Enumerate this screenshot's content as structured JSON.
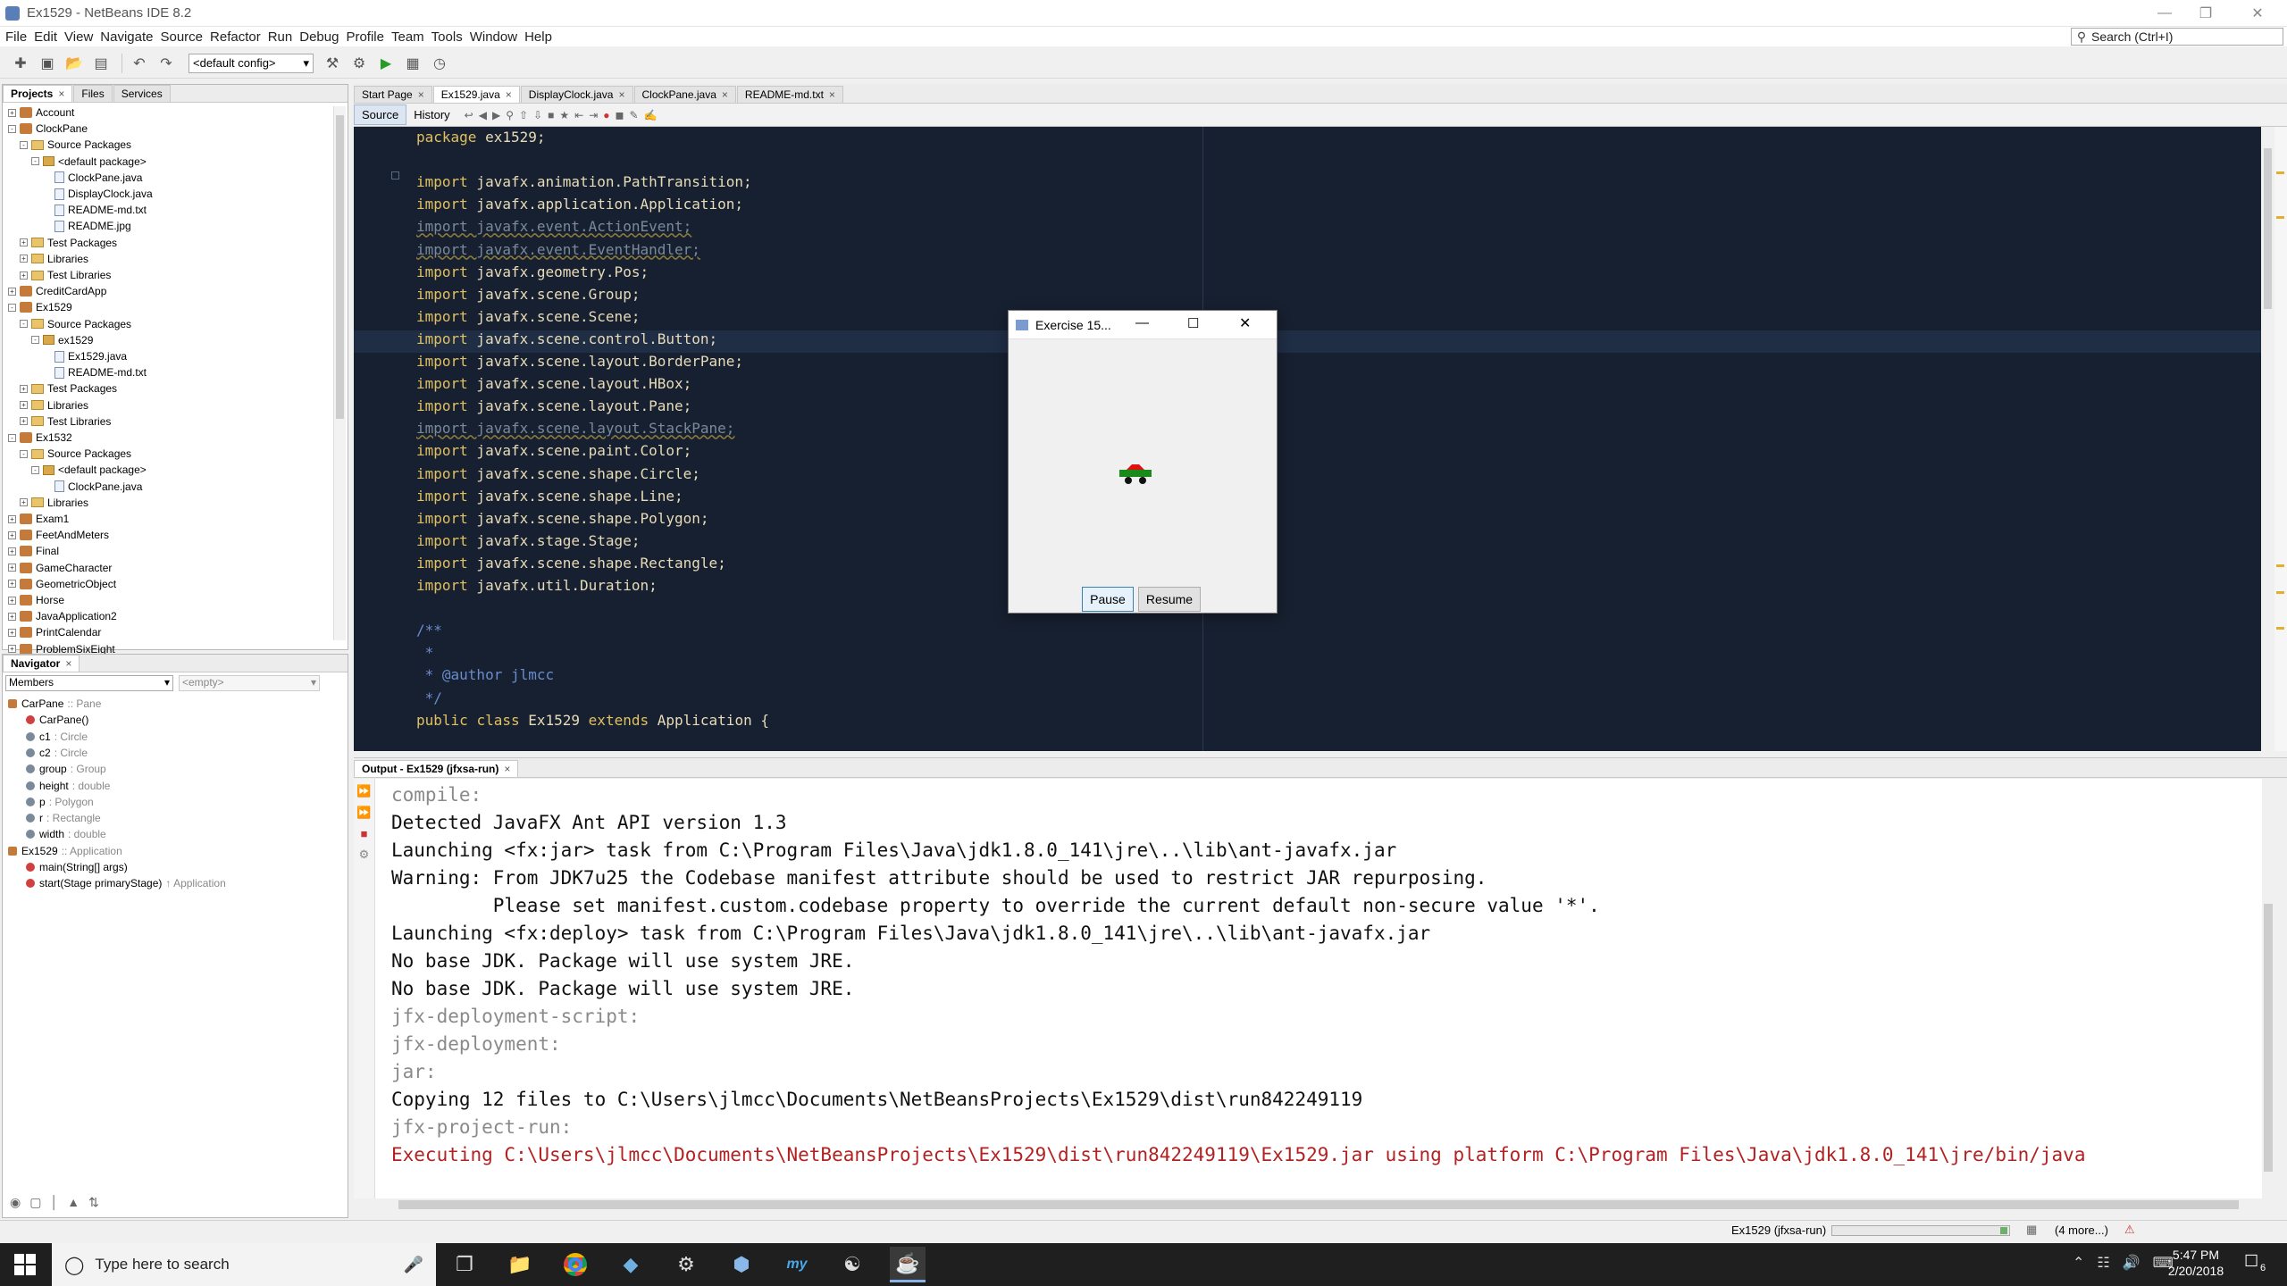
{
  "window": {
    "title": "Ex1529 - NetBeans IDE 8.2"
  },
  "menus": [
    "File",
    "Edit",
    "View",
    "Navigate",
    "Source",
    "Refactor",
    "Run",
    "Debug",
    "Profile",
    "Team",
    "Tools",
    "Window",
    "Help"
  ],
  "search": {
    "placeholder": "Search (Ctrl+I)"
  },
  "toolbar": {
    "config": "<default config>"
  },
  "projects_panel": {
    "tabs": [
      "Projects",
      "Files",
      "Services"
    ],
    "tree": [
      {
        "label": "Account",
        "level": 0,
        "icon": "project-icon",
        "exp": "+"
      },
      {
        "label": "ClockPane",
        "level": 0,
        "icon": "project-icon",
        "exp": "-"
      },
      {
        "label": "Source Packages",
        "level": 1,
        "icon": "folder-icon",
        "exp": "-"
      },
      {
        "label": "<default package>",
        "level": 2,
        "icon": "package-icon",
        "exp": "-"
      },
      {
        "label": "ClockPane.java",
        "level": 3,
        "icon": "java-file-icon",
        "exp": ""
      },
      {
        "label": "DisplayClock.java",
        "level": 3,
        "icon": "java-file-icon",
        "exp": ""
      },
      {
        "label": "README-md.txt",
        "level": 3,
        "icon": "text-file-icon",
        "exp": ""
      },
      {
        "label": "README.jpg",
        "level": 3,
        "icon": "image-file-icon",
        "exp": ""
      },
      {
        "label": "Test Packages",
        "level": 1,
        "icon": "folder-icon",
        "exp": "+"
      },
      {
        "label": "Libraries",
        "level": 1,
        "icon": "folder-icon",
        "exp": "+"
      },
      {
        "label": "Test Libraries",
        "level": 1,
        "icon": "folder-icon",
        "exp": "+"
      },
      {
        "label": "CreditCardApp",
        "level": 0,
        "icon": "project-icon",
        "exp": "+"
      },
      {
        "label": "Ex1529",
        "level": 0,
        "icon": "project-icon",
        "exp": "-"
      },
      {
        "label": "Source Packages",
        "level": 1,
        "icon": "folder-icon",
        "exp": "-"
      },
      {
        "label": "ex1529",
        "level": 2,
        "icon": "package-icon",
        "exp": "-"
      },
      {
        "label": "Ex1529.java",
        "level": 3,
        "icon": "java-file-icon",
        "exp": ""
      },
      {
        "label": "README-md.txt",
        "level": 3,
        "icon": "text-file-icon",
        "exp": ""
      },
      {
        "label": "Test Packages",
        "level": 1,
        "icon": "folder-icon",
        "exp": "+"
      },
      {
        "label": "Libraries",
        "level": 1,
        "icon": "folder-icon",
        "exp": "+"
      },
      {
        "label": "Test Libraries",
        "level": 1,
        "icon": "folder-icon",
        "exp": "+"
      },
      {
        "label": "Ex1532",
        "level": 0,
        "icon": "project-icon",
        "exp": "-"
      },
      {
        "label": "Source Packages",
        "level": 1,
        "icon": "folder-icon",
        "exp": "-"
      },
      {
        "label": "<default package>",
        "level": 2,
        "icon": "package-icon",
        "exp": "-"
      },
      {
        "label": "ClockPane.java",
        "level": 3,
        "icon": "java-file-icon",
        "exp": ""
      },
      {
        "label": "Libraries",
        "level": 1,
        "icon": "folder-icon",
        "exp": "+"
      },
      {
        "label": "Exam1",
        "level": 0,
        "icon": "project-icon",
        "exp": "+"
      },
      {
        "label": "FeetAndMeters",
        "level": 0,
        "icon": "project-icon",
        "exp": "+"
      },
      {
        "label": "Final",
        "level": 0,
        "icon": "project-icon",
        "exp": "+"
      },
      {
        "label": "GameCharacter",
        "level": 0,
        "icon": "project-icon",
        "exp": "+"
      },
      {
        "label": "GeometricObject",
        "level": 0,
        "icon": "project-icon",
        "exp": "+"
      },
      {
        "label": "Horse",
        "level": 0,
        "icon": "project-icon",
        "exp": "+"
      },
      {
        "label": "JavaApplication2",
        "level": 0,
        "icon": "project-icon",
        "exp": "+"
      },
      {
        "label": "PrintCalendar",
        "level": 0,
        "icon": "project-icon",
        "exp": "+"
      },
      {
        "label": "ProblemSixEight",
        "level": 0,
        "icon": "project-icon",
        "exp": "+"
      }
    ]
  },
  "navigator": {
    "tab": "Navigator",
    "filter": "Members",
    "filter2": "<empty>",
    "items": [
      {
        "label": "CarPane",
        "type": ":: Pane",
        "level": 0
      },
      {
        "label": "CarPane()",
        "type": "",
        "level": 1
      },
      {
        "label": "c1",
        "type": ": Circle",
        "level": 1
      },
      {
        "label": "c2",
        "type": ": Circle",
        "level": 1
      },
      {
        "label": "group",
        "type": ": Group",
        "level": 1
      },
      {
        "label": "height",
        "type": ": double",
        "level": 1
      },
      {
        "label": "p",
        "type": ": Polygon",
        "level": 1
      },
      {
        "label": "r",
        "type": ": Rectangle",
        "level": 1
      },
      {
        "label": "width",
        "type": ": double",
        "level": 1
      },
      {
        "label": "Ex1529",
        "type": ":: Application",
        "level": 0
      },
      {
        "label": "main(String[] args)",
        "type": "",
        "level": 1
      },
      {
        "label": "start(Stage primaryStage)",
        "type": "↑ Application",
        "level": 1
      }
    ]
  },
  "editor": {
    "tabs": [
      {
        "label": "Start Page",
        "active": false
      },
      {
        "label": "Ex1529.java",
        "active": true
      },
      {
        "label": "DisplayClock.java",
        "active": false
      },
      {
        "label": "ClockPane.java",
        "active": false
      },
      {
        "label": "README-md.txt",
        "active": false
      }
    ],
    "subtabs": [
      "Source",
      "History"
    ],
    "lines": [
      {
        "text": "package ex1529;",
        "style": "normal"
      },
      {
        "text": "",
        "style": "normal"
      },
      {
        "text": "import javafx.animation.PathTransition;",
        "style": "normal"
      },
      {
        "text": "import javafx.application.Application;",
        "style": "normal"
      },
      {
        "text": "import javafx.event.ActionEvent;",
        "style": "unused"
      },
      {
        "text": "import javafx.event.EventHandler;",
        "style": "unused"
      },
      {
        "text": "import javafx.geometry.Pos;",
        "style": "normal"
      },
      {
        "text": "import javafx.scene.Group;",
        "style": "normal"
      },
      {
        "text": "import javafx.scene.Scene;",
        "style": "normal"
      },
      {
        "text": "import javafx.scene.control.Button;",
        "style": "normal"
      },
      {
        "text": "import javafx.scene.layout.BorderPane;",
        "style": "normal"
      },
      {
        "text": "import javafx.scene.layout.HBox;",
        "style": "normal"
      },
      {
        "text": "import javafx.scene.layout.Pane;",
        "style": "normal"
      },
      {
        "text": "import javafx.scene.layout.StackPane;",
        "style": "unused"
      },
      {
        "text": "import javafx.scene.paint.Color;",
        "style": "normal"
      },
      {
        "text": "import javafx.scene.shape.Circle;",
        "style": "normal"
      },
      {
        "text": "import javafx.scene.shape.Line;",
        "style": "normal"
      },
      {
        "text": "import javafx.scene.shape.Polygon;",
        "style": "normal"
      },
      {
        "text": "import javafx.stage.Stage;",
        "style": "normal"
      },
      {
        "text": "import javafx.scene.shape.Rectangle;",
        "style": "normal"
      },
      {
        "text": "import javafx.util.Duration;",
        "style": "normal"
      },
      {
        "text": "",
        "style": "normal"
      },
      {
        "text": "/**",
        "style": "comment"
      },
      {
        "text": " *",
        "style": "comment"
      },
      {
        "text": " * @author jlmcc",
        "style": "comment"
      },
      {
        "text": " */",
        "style": "comment"
      },
      {
        "text": "public class Ex1529 extends Application {",
        "style": "normal"
      }
    ]
  },
  "output": {
    "tab": "Output - Ex1529 (jfxsa-run)",
    "lines": [
      {
        "text": "compile:",
        "style": "gray"
      },
      {
        "text": "Detected JavaFX Ant API version 1.3",
        "style": "normal"
      },
      {
        "text": "Launching <fx:jar> task from C:\\Program Files\\Java\\jdk1.8.0_141\\jre\\..\\lib\\ant-javafx.jar",
        "style": "normal"
      },
      {
        "text": "Warning: From JDK7u25 the Codebase manifest attribute should be used to restrict JAR repurposing.",
        "style": "normal"
      },
      {
        "text": "         Please set manifest.custom.codebase property to override the current default non-secure value '*'.",
        "style": "normal"
      },
      {
        "text": "Launching <fx:deploy> task from C:\\Program Files\\Java\\jdk1.8.0_141\\jre\\..\\lib\\ant-javafx.jar",
        "style": "normal"
      },
      {
        "text": "No base JDK. Package will use system JRE.",
        "style": "normal"
      },
      {
        "text": "No base JDK. Package will use system JRE.",
        "style": "normal"
      },
      {
        "text": "jfx-deployment-script:",
        "style": "gray"
      },
      {
        "text": "jfx-deployment:",
        "style": "gray"
      },
      {
        "text": "jar:",
        "style": "gray"
      },
      {
        "text": "Copying 12 files to C:\\Users\\jlmcc\\Documents\\NetBeansProjects\\Ex1529\\dist\\run842249119",
        "style": "normal"
      },
      {
        "text": "jfx-project-run:",
        "style": "gray"
      },
      {
        "text": "Executing C:\\Users\\jlmcc\\Documents\\NetBeansProjects\\Ex1529\\dist\\run842249119\\Ex1529.jar using platform C:\\Program Files\\Java\\jdk1.8.0_141\\jre/bin/java",
        "style": "red"
      }
    ]
  },
  "dialog": {
    "title": "Exercise 15...",
    "pause": "Pause",
    "resume": "Resume"
  },
  "statusbar": {
    "task": "Ex1529 (jfxsa-run)",
    "more": "(4 more...)"
  },
  "taskbar": {
    "search_placeholder": "Type here to search",
    "time": "5:47 PM",
    "date": "2/20/2018",
    "notifications": "6"
  },
  "colors": {
    "editor_bg": "#172030",
    "output_error": "#b22222",
    "car_body": "#1a8a1a",
    "car_roof": "#e01010"
  }
}
